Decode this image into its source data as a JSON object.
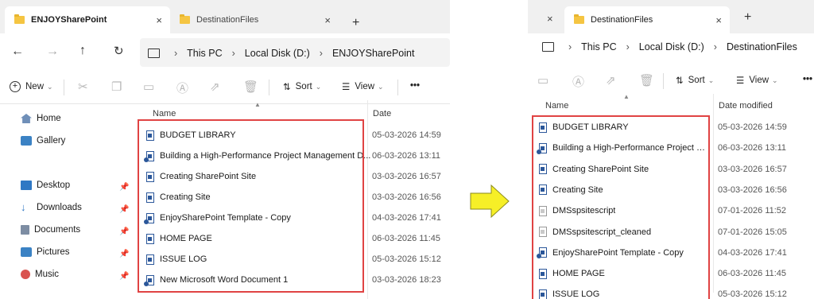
{
  "left": {
    "tabs": [
      {
        "label": "ENJOYSharePoint",
        "close": "×"
      },
      {
        "label": "DestinationFiles",
        "close": "×"
      }
    ],
    "new_tab": "+",
    "breadcrumb": [
      "This PC",
      "Local Disk (D:)",
      "ENJOYSharePoint"
    ],
    "toolbar": {
      "new": "New",
      "sort": "Sort",
      "view": "View",
      "more": "•••"
    },
    "columns": {
      "name": "Name",
      "date": "Date"
    },
    "nav": [
      {
        "label": "Home",
        "icon": "home-icon"
      },
      {
        "label": "Gallery",
        "icon": "gallery-icon"
      },
      {
        "label": "Desktop",
        "icon": "desktop-icon"
      },
      {
        "label": "Downloads",
        "icon": "download-icon"
      },
      {
        "label": "Documents",
        "icon": "documents-icon"
      },
      {
        "label": "Pictures",
        "icon": "pictures-icon"
      },
      {
        "label": "Music",
        "icon": "music-icon"
      }
    ],
    "files": [
      {
        "name": "BUDGET LIBRARY",
        "date": "05-03-2026 14:59"
      },
      {
        "name": "Building a High-Performance Project Management D...",
        "date": "06-03-2026 13:11"
      },
      {
        "name": "Creating SharePoint Site",
        "date": "03-03-2026 16:57"
      },
      {
        "name": "Creating Site",
        "date": "03-03-2026 16:56"
      },
      {
        "name": "EnjoySharePoint Template - Copy",
        "date": "04-03-2026 17:41"
      },
      {
        "name": "HOME PAGE",
        "date": "06-03-2026 11:45"
      },
      {
        "name": "ISSUE LOG",
        "date": "05-03-2026 15:12"
      },
      {
        "name": "New Microsoft Word Document 1",
        "date": "03-03-2026 18:23"
      }
    ]
  },
  "right": {
    "tabs": [
      {
        "label": "DestinationFiles",
        "close": "×"
      }
    ],
    "close_left": "×",
    "new_tab": "+",
    "breadcrumb": [
      "This PC",
      "Local Disk (D:)",
      "DestinationFiles"
    ],
    "toolbar": {
      "sort": "Sort",
      "view": "View",
      "more": "•••"
    },
    "columns": {
      "name": "Name",
      "date": "Date modified"
    },
    "files": [
      {
        "name": "BUDGET LIBRARY",
        "date": "05-03-2026 14:59"
      },
      {
        "name": "Building a High-Performance Project Ma...",
        "date": "06-03-2026 13:11"
      },
      {
        "name": "Creating SharePoint Site",
        "date": "03-03-2026 16:57"
      },
      {
        "name": "Creating Site",
        "date": "03-03-2026 16:56"
      },
      {
        "name": "DMSspsitescript",
        "date": "07-01-2026 11:52"
      },
      {
        "name": "DMSspsitescript_cleaned",
        "date": "07-01-2026 15:05"
      },
      {
        "name": "EnjoySharePoint Template - Copy",
        "date": "04-03-2026 17:41"
      },
      {
        "name": "HOME PAGE",
        "date": "06-03-2026 11:45"
      },
      {
        "name": "ISSUE LOG",
        "date": "05-03-2026 15:12"
      }
    ]
  },
  "colors": {
    "highlight": "#e04343",
    "arrow": "#f6ef27",
    "folder": "#f5c542",
    "word": "#2b579a"
  }
}
